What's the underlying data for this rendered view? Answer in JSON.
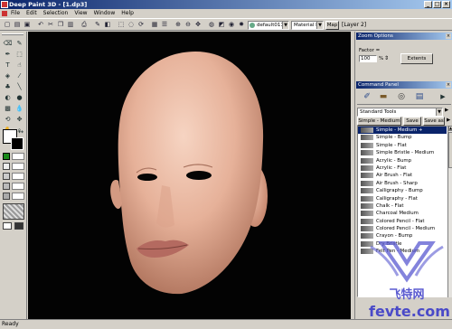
{
  "window": {
    "title": "Deep Paint 3D - [1.dp3]",
    "min": "_",
    "max": "□",
    "close": "×"
  },
  "menu": [
    "File",
    "Edit",
    "Selection",
    "View",
    "Window",
    "Help"
  ],
  "toolbar": {
    "material_dropdown": "default011",
    "material_select": "Material B",
    "map_button": "Map",
    "layer_label": "[Layer 2]"
  },
  "zoom_panel": {
    "title": "Zoom Options",
    "factor_label": "Factor =",
    "factor_value": "100",
    "percent": "%",
    "extents_button": "Extents"
  },
  "command_panel": {
    "title": "Command Panel",
    "tools_dropdown": "Standard Tools",
    "preset": "Simple - Medium",
    "save": "Save",
    "save_as": "Save as"
  },
  "brushes": [
    "Simple - Medium +",
    "Simple - Bump",
    "Simple - Flat",
    "Simple Bristle - Medium",
    "Acrylic - Bump",
    "Acrylic - Flat",
    "Air Brush - Flat",
    "Air Brush - Sharp",
    "Calligraphy - Bump",
    "Calligraphy - Flat",
    "Chalk - Flat",
    "Charcoal Medium",
    "Colored Pencil - Flat",
    "Colored Pencil - Medium",
    "Crayon - Bump",
    "Dry Bristle",
    "Felt Pen - Medium"
  ],
  "status": "Ready",
  "watermark": {
    "line1": "飞特网",
    "line2": "fevte.com"
  },
  "colors": {
    "title_dark": "#0a246a",
    "title_light": "#a6caf0",
    "chrome": "#d4d0c8",
    "canvas": "#030303",
    "skin": "#e8b8a0",
    "watermark": "#5a5ad0"
  }
}
